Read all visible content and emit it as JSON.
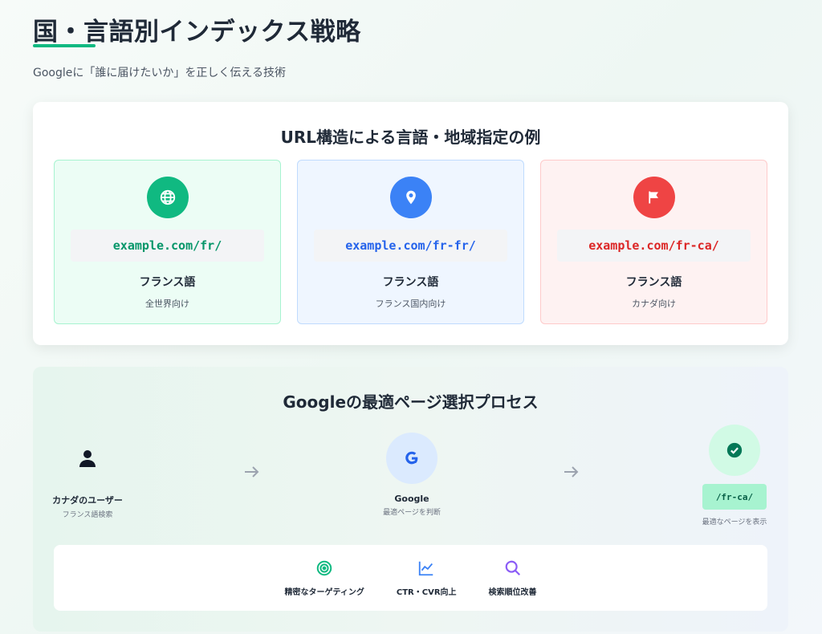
{
  "header": {
    "title": "国・言語別インデックス戦略",
    "subtitle": "Googleに「誰に届けたいか」を正しく伝える技術"
  },
  "url_section": {
    "title": "URL構造による言語・地域指定の例",
    "examples": [
      {
        "icon": "globe-icon",
        "url": "example.com/fr/",
        "language": "フランス語",
        "target": "全世界向け",
        "color": "#10b981"
      },
      {
        "icon": "location-pin-icon",
        "url": "example.com/fr-fr/",
        "language": "フランス語",
        "target": "フランス国内向け",
        "color": "#3b82f6"
      },
      {
        "icon": "flag-icon",
        "url": "example.com/fr-ca/",
        "language": "フランス語",
        "target": "カナダ向け",
        "color": "#ef4444"
      }
    ]
  },
  "process_section": {
    "title": "Googleの最適ページ選択プロセス",
    "steps": [
      {
        "icon": "user-icon",
        "name": "カナダのユーザー",
        "desc": "フランス語検索"
      },
      {
        "icon": "google-icon",
        "name": "Google",
        "desc": "最適ページを判断"
      },
      {
        "icon": "check-circle-icon",
        "code": "/fr-ca/",
        "desc": "最適なページを表示"
      }
    ],
    "benefits": [
      {
        "icon": "target-icon",
        "label": "精密なターゲティング",
        "color": "#10b981"
      },
      {
        "icon": "chart-line-icon",
        "label": "CTR・CVR向上",
        "color": "#3b82f6"
      },
      {
        "icon": "search-icon",
        "label": "検索順位改善",
        "color": "#8b5cf6"
      }
    ]
  }
}
